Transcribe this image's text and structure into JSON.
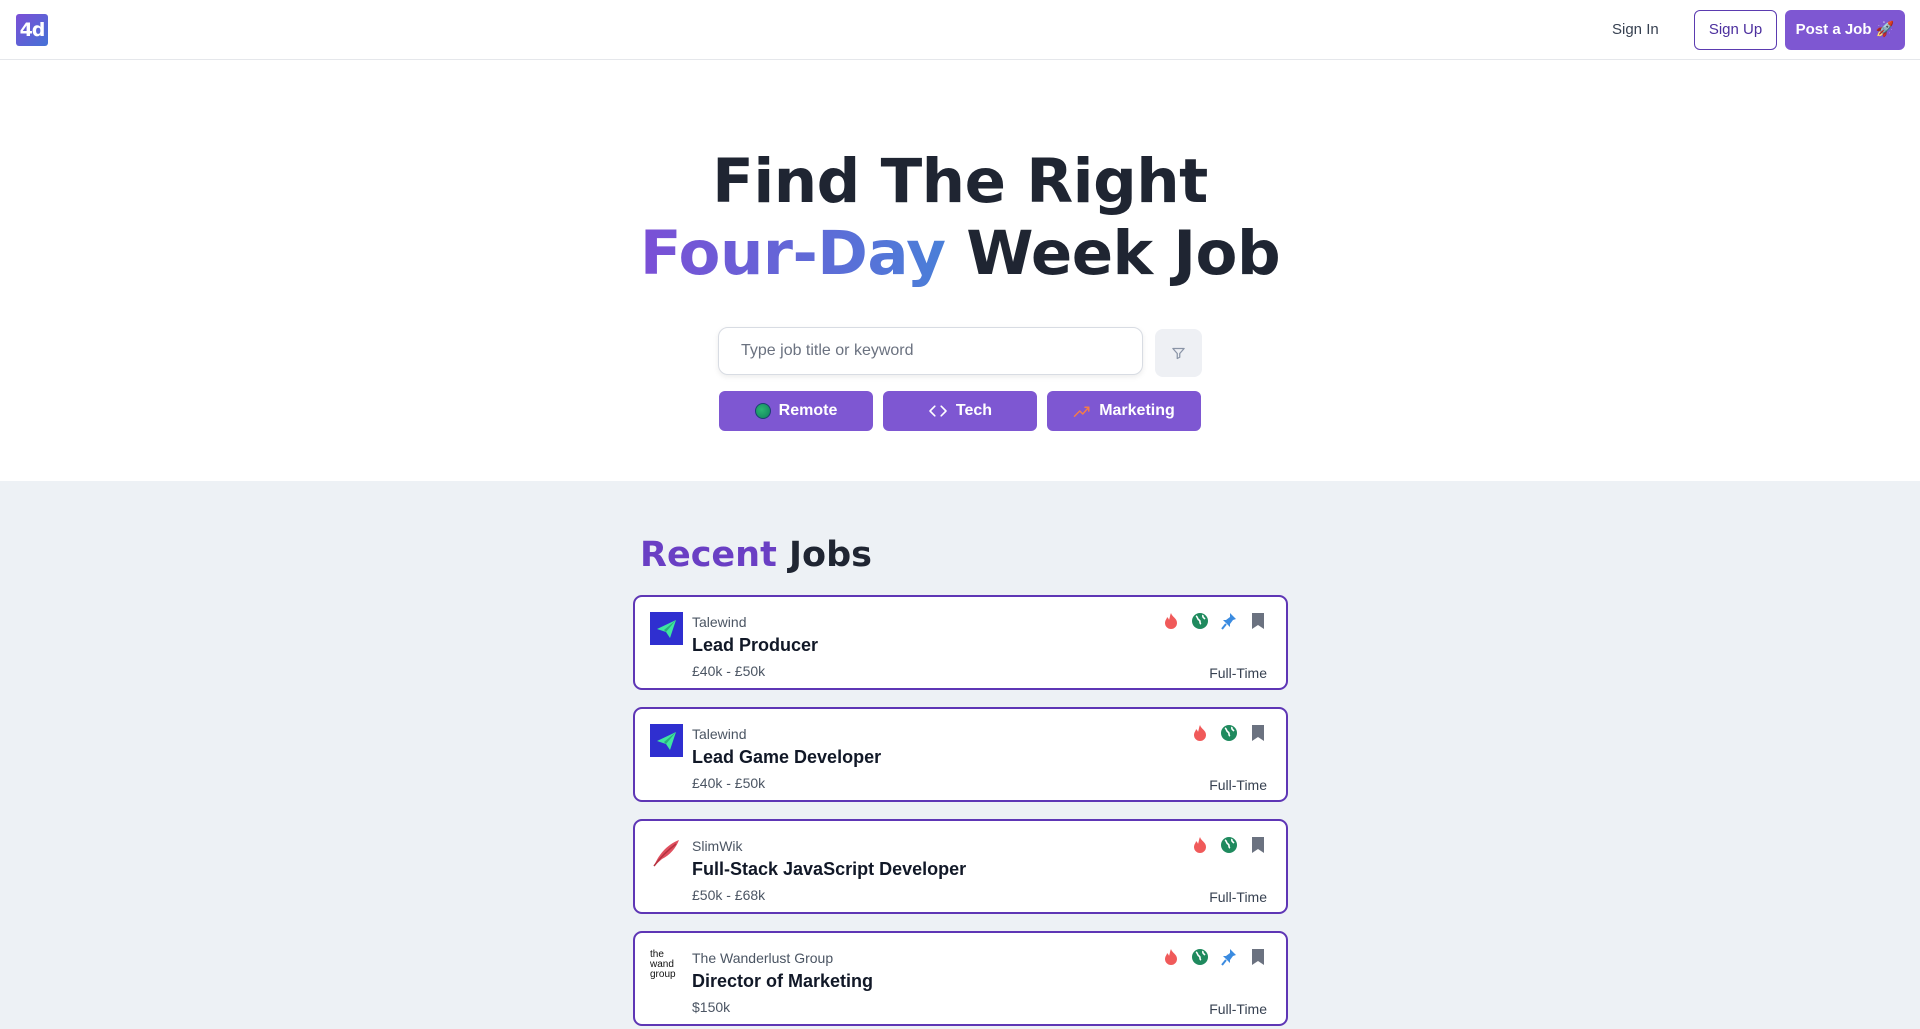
{
  "header": {
    "logo_text": "4d",
    "sign_in": "Sign In",
    "sign_up": "Sign Up",
    "post_job": "Post a Job 🚀"
  },
  "hero": {
    "line1": "Find The Right",
    "line2_highlight": "Four-Day",
    "line2_rest": " Week Job"
  },
  "search": {
    "placeholder": "Type job title or keyword",
    "value": ""
  },
  "filters": [
    {
      "label": "Remote",
      "icon": "globe-icon"
    },
    {
      "label": "Tech",
      "icon": "code-icon"
    },
    {
      "label": "Marketing",
      "icon": "trending-up-icon"
    }
  ],
  "jobs_section": {
    "heading_accent": "Recent",
    "heading_rest": " Jobs"
  },
  "jobs": [
    {
      "company": "Talewind",
      "title": "Lead Producer",
      "salary": "£40k - £50k",
      "type": "Full-Time",
      "logo": "talewind-logo",
      "icons": [
        "fire-icon",
        "globe-icon",
        "pin-icon",
        "bookmark-icon"
      ]
    },
    {
      "company": "Talewind",
      "title": "Lead Game Developer",
      "salary": "£40k - £50k",
      "type": "Full-Time",
      "logo": "talewind-logo",
      "icons": [
        "fire-icon",
        "globe-icon",
        "bookmark-icon"
      ]
    },
    {
      "company": "SlimWik",
      "title": "Full-Stack JavaScript Developer",
      "salary": "£50k - £68k",
      "type": "Full-Time",
      "logo": "slimwik-logo",
      "icons": [
        "fire-icon",
        "globe-icon",
        "bookmark-icon"
      ]
    },
    {
      "company": "The Wanderlust Group",
      "title": "Director of Marketing",
      "salary": "$150k",
      "type": "Full-Time",
      "logo": "wanderlust-logo",
      "logo_text": "the wanderlust group",
      "icons": [
        "fire-icon",
        "globe-icon",
        "pin-icon",
        "bookmark-icon"
      ]
    }
  ],
  "colors": {
    "brand_purple": "#7e57d2",
    "card_border": "#5e36b5",
    "gradient_start": "#7b4fd6",
    "gradient_end": "#4a7fd8",
    "section_bg": "#edf1f5"
  }
}
